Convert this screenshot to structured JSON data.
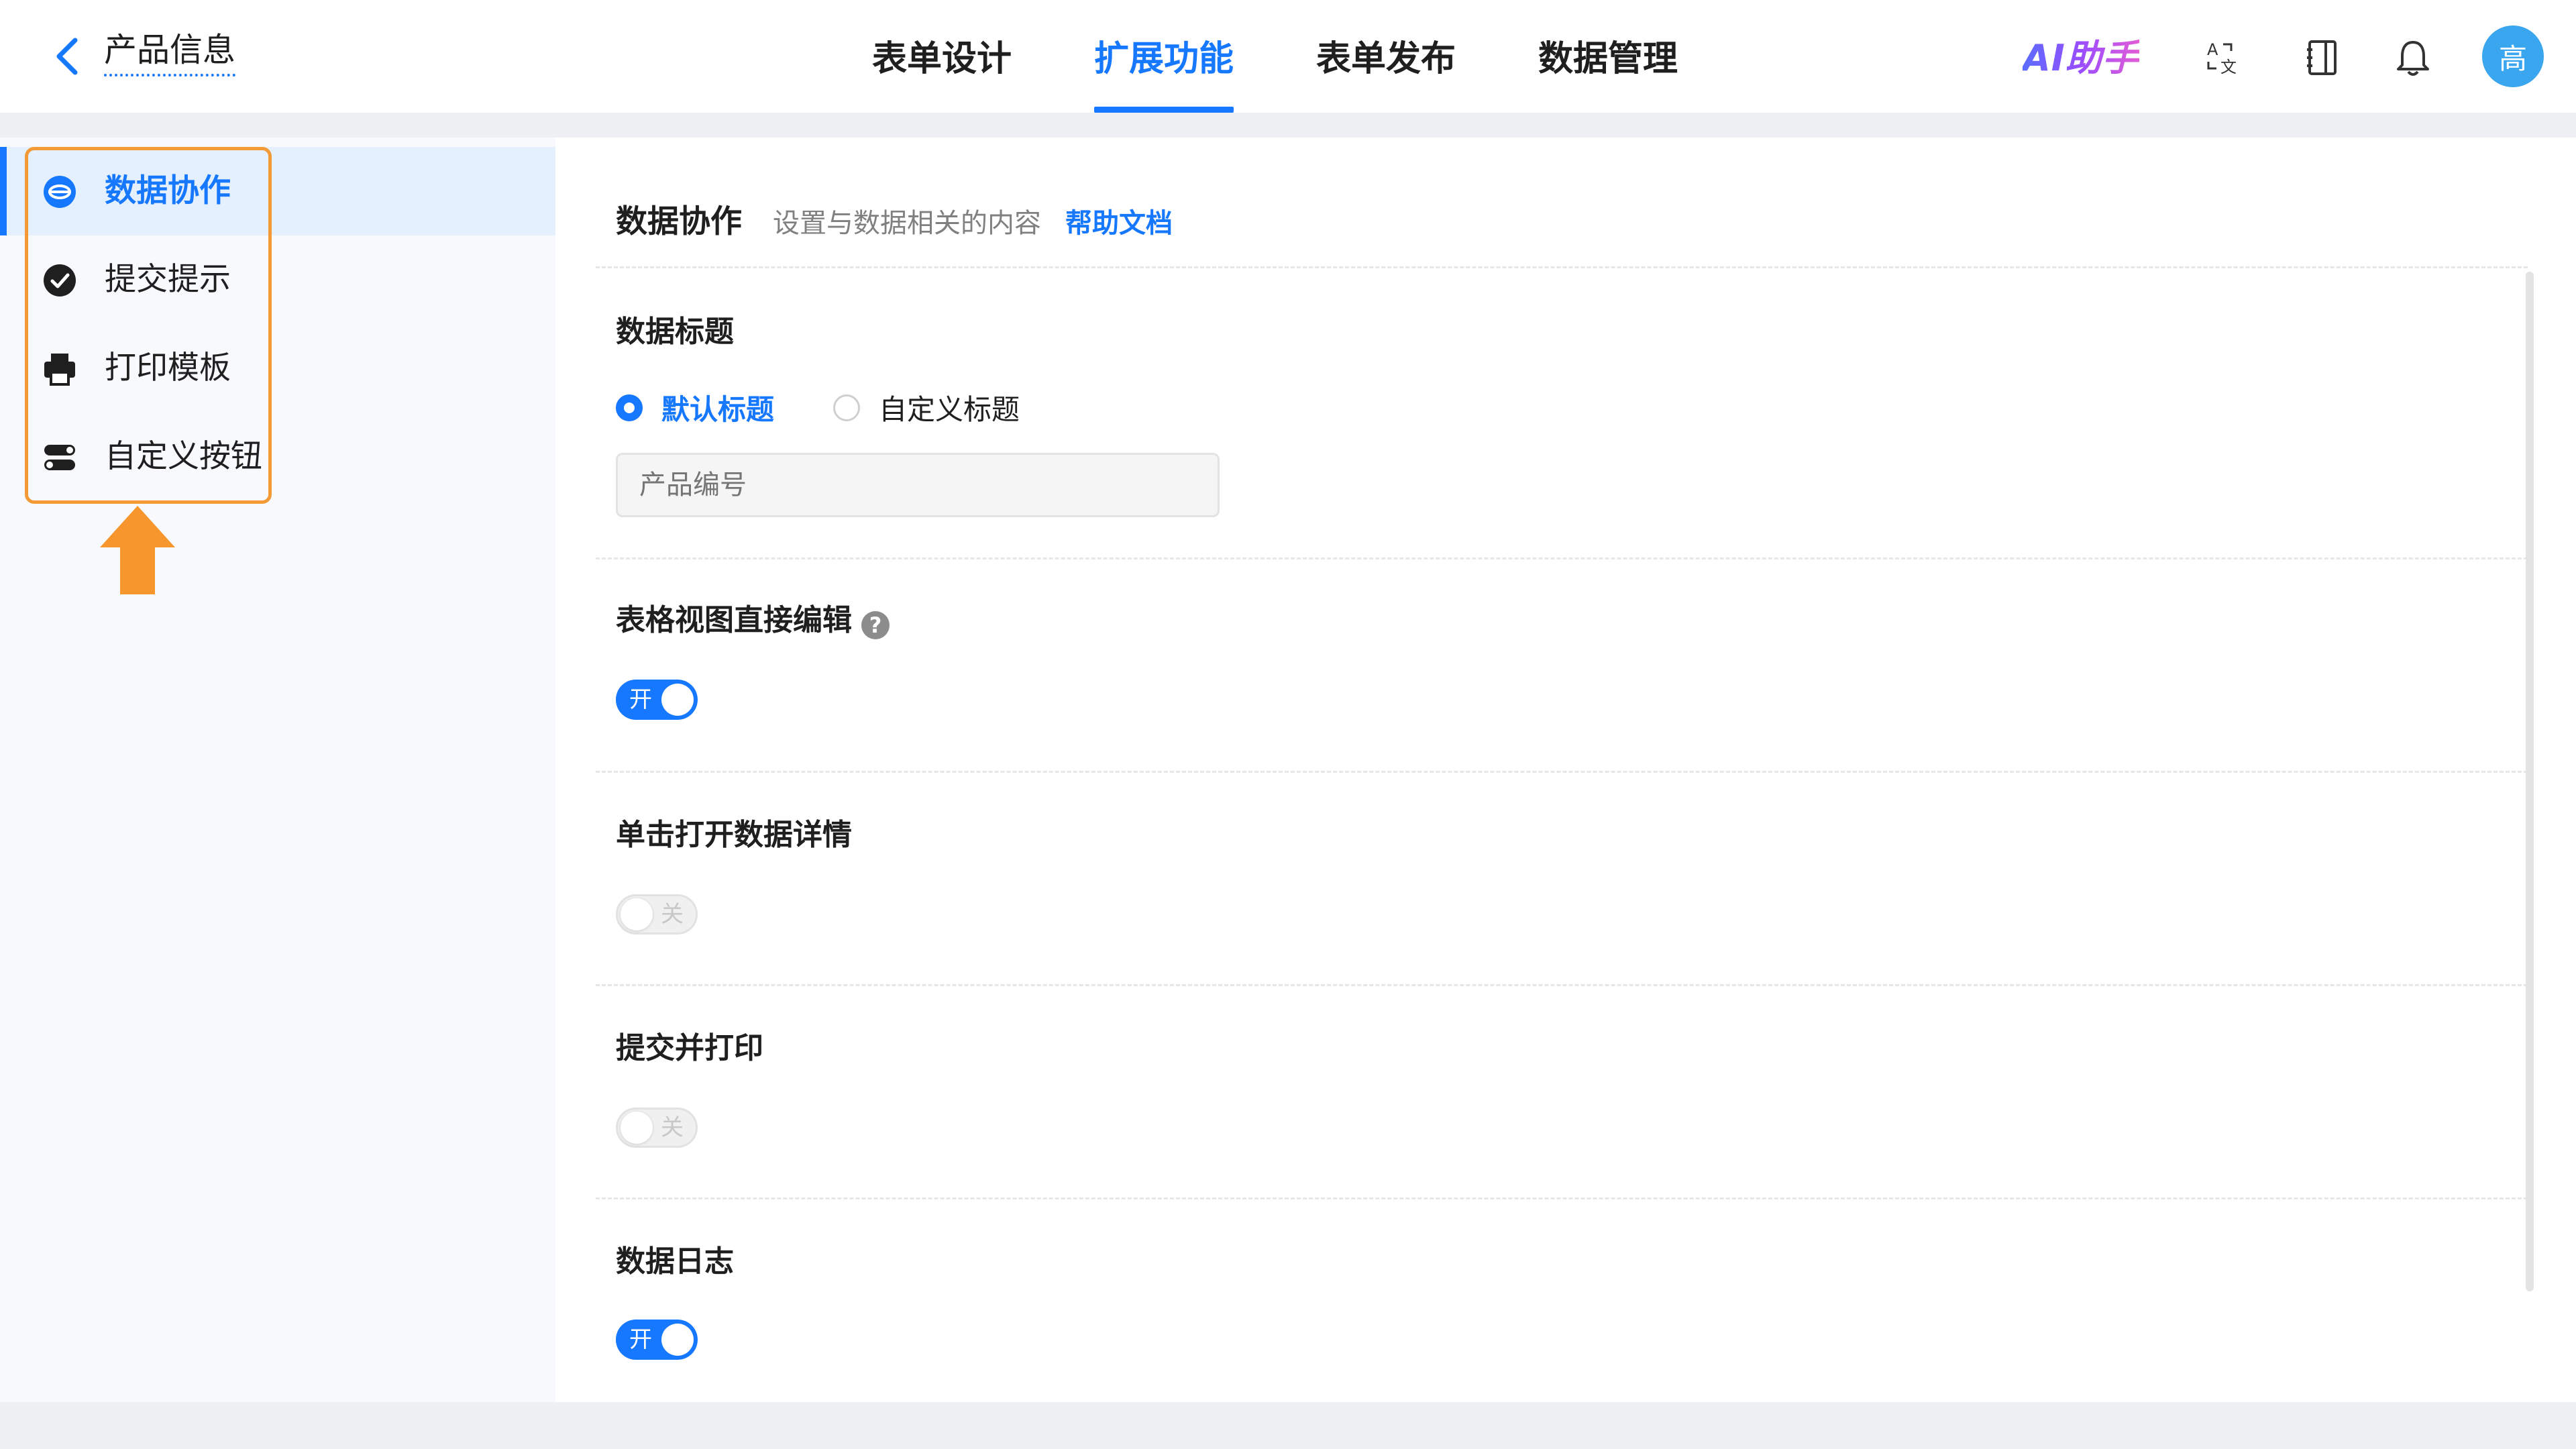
{
  "header": {
    "page_name": "产品信息",
    "tabs": [
      {
        "label": "表单设计",
        "active": false
      },
      {
        "label": "扩展功能",
        "active": true
      },
      {
        "label": "表单发布",
        "active": false
      },
      {
        "label": "数据管理",
        "active": false
      }
    ],
    "ai_label": "AI助手",
    "avatar_text": "高",
    "icons": [
      "translate-icon",
      "book-icon",
      "bell-icon"
    ]
  },
  "sidebar": {
    "items": [
      {
        "label": "数据协作",
        "icon": "collaboration-icon",
        "active": true
      },
      {
        "label": "提交提示",
        "icon": "check-circle-icon",
        "active": false
      },
      {
        "label": "打印模板",
        "icon": "printer-icon",
        "active": false
      },
      {
        "label": "自定义按钮",
        "icon": "toggle-buttons-icon",
        "active": false
      }
    ]
  },
  "main": {
    "title": "数据协作",
    "subtitle": "设置与数据相关的内容",
    "help_link": "帮助文档",
    "data_title": {
      "label": "数据标题",
      "options": [
        "默认标题",
        "自定义标题"
      ],
      "selected": "默认标题",
      "input_placeholder": "产品编号"
    },
    "settings": [
      {
        "label": "表格视图直接编辑",
        "has_help": true,
        "state": "on",
        "state_text": "开"
      },
      {
        "label": "单击打开数据详情",
        "has_help": false,
        "state": "off",
        "state_text": "关"
      },
      {
        "label": "提交并打印",
        "has_help": false,
        "state": "off",
        "state_text": "关"
      },
      {
        "label": "数据日志",
        "has_help": false,
        "state": "on",
        "state_text": "开"
      }
    ]
  },
  "colors": {
    "accent": "#1677ff",
    "highlight_border": "#f39a37",
    "avatar_bg": "#3aa6ef"
  }
}
